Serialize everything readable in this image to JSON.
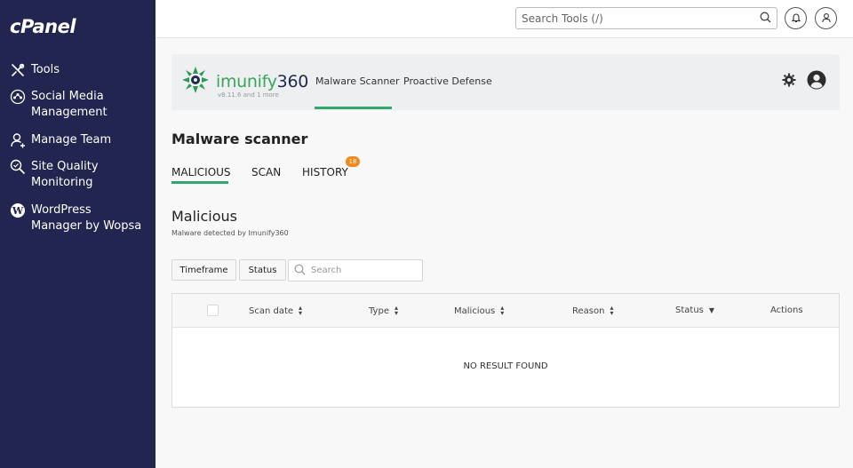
{
  "sidebar": {
    "logo": "cPanel",
    "items": [
      {
        "label": "Tools",
        "icon": "tools-icon"
      },
      {
        "label": "Social Media\nManagement",
        "icon": "social-media-icon"
      },
      {
        "label": "Manage Team",
        "icon": "manage-team-icon"
      },
      {
        "label": "Site Quality\nMonitoring",
        "icon": "site-quality-icon"
      },
      {
        "label": "WordPress\nManager by Wopsa",
        "icon": "wordpress-icon"
      }
    ]
  },
  "topbar": {
    "search_placeholder": "Search Tools (/)"
  },
  "imunify": {
    "brand_text": "imunify",
    "brand_number": "360",
    "version": "v8.11.6 and 1 more",
    "tabs": [
      {
        "label": "Malware Scanner",
        "active": true
      },
      {
        "label": "Proactive Defense",
        "active": false
      }
    ]
  },
  "page": {
    "title": "Malware scanner",
    "tabs": [
      {
        "label": "MALICIOUS",
        "active": true
      },
      {
        "label": "SCAN",
        "active": false
      },
      {
        "label": "HISTORY",
        "active": false,
        "badge": "18"
      }
    ],
    "section_title": "Malicious",
    "section_subtitle": "Malware detected by Imunify360"
  },
  "filters": {
    "timeframe_label": "Timeframe",
    "status_label": "Status",
    "search_placeholder": "Search"
  },
  "table": {
    "columns": [
      "Scan date",
      "Type",
      "Malicious",
      "Reason",
      "Status",
      "Actions"
    ],
    "empty_text": "NO RESULT FOUND"
  },
  "colors": {
    "sidebar_bg": "#21254f",
    "accent_green": "#2ea86b",
    "badge_orange": "#f08a1c"
  }
}
